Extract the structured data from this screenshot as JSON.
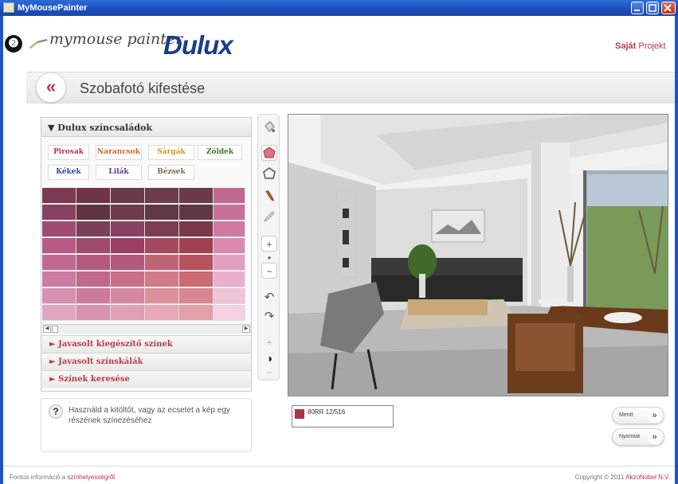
{
  "window": {
    "title": "MyMousePainter"
  },
  "header": {
    "step": "❷",
    "logo_script": "mymouse painter",
    "logo_brand": "Dulux",
    "project_bold": "Saját",
    "project_rest": "Projekt"
  },
  "page": {
    "back": "«",
    "title": "Szobafotó kifestése"
  },
  "panel": {
    "heading": "▼ Dulux színcsaládok",
    "families": [
      {
        "label": "Pirosak",
        "color": "#c0304a"
      },
      {
        "label": "Narancsok",
        "color": "#d4602c"
      },
      {
        "label": "Sárgák",
        "color": "#d09a1a"
      },
      {
        "label": "Zöldek",
        "color": "#3f7a2c"
      },
      {
        "label": "Kékek",
        "color": "#2d4c94"
      },
      {
        "label": "Lilák",
        "color": "#5b3a8c"
      },
      {
        "label": "Bézsek",
        "color": "#7a6a52"
      }
    ],
    "accordion": [
      "► Javasolt kiegészítő színek",
      "► Javasolt színskálák",
      "► Színek keresése"
    ]
  },
  "help": {
    "icon": "?",
    "text": "Használd a kitöltőt, vagy az ecsetet a kép egy részének színezéséhez"
  },
  "tools": {
    "zoom_in": "+",
    "zoom_dot": "•",
    "zoom_out": "−",
    "undo": "↶",
    "redo": "↷",
    "contrast_plus": "+",
    "contrast_icon": "◑",
    "contrast_minus": "−"
  },
  "selected_color": {
    "code": "80RR 12/516",
    "hex": "#a8354a"
  },
  "buttons": {
    "next": "Mentt",
    "print": "Nyomtat",
    "chevron": "»"
  },
  "footer": {
    "left_prefix": "Fontos információ a",
    "left_link": "színhelyességről",
    "right_prefix": "Copyright © 2011",
    "right_link": "AkzoNobel N.V."
  },
  "colors": {
    "accent": "#c0304a",
    "brand": "#1c3d86",
    "titlebar": "#1f55c0"
  }
}
